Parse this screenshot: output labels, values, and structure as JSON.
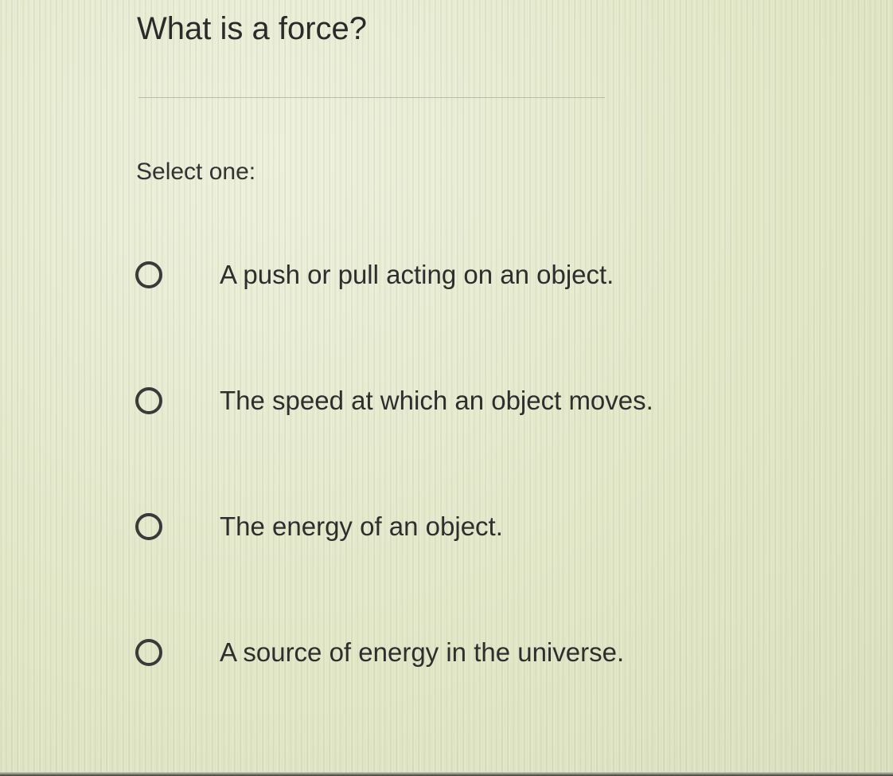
{
  "question": {
    "text": "What is a force?"
  },
  "instruction": "Select one:",
  "options": [
    {
      "label": "A push or pull acting on an object.",
      "selected": false
    },
    {
      "label": "The speed at which an object moves.",
      "selected": false
    },
    {
      "label": "The energy of an object.",
      "selected": false
    },
    {
      "label": "A source of energy in the universe.",
      "selected": false
    }
  ],
  "colors": {
    "background": "#e4e8cf",
    "text": "#2b2b2b",
    "radio_border": "#3a3a3a",
    "divider": "#b9bca6"
  }
}
